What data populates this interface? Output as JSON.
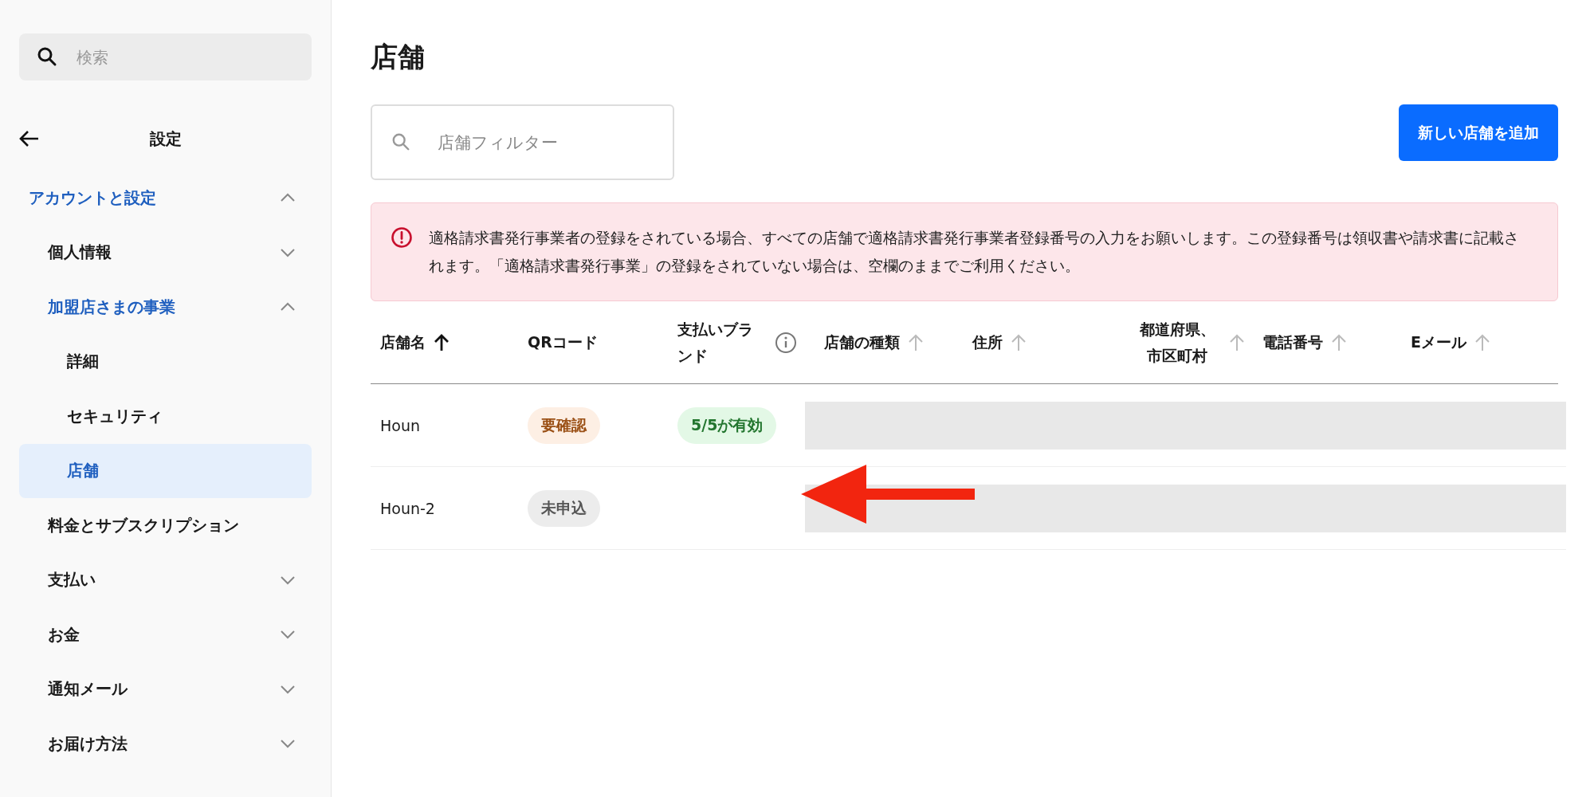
{
  "sidebar": {
    "search": {
      "placeholder": "検索"
    },
    "title": "設定",
    "items": [
      {
        "label": "アカウントと設定",
        "expanded": true,
        "selected": false,
        "children": [
          {
            "label": "個人情報",
            "expanded": false,
            "selected": false
          },
          {
            "label": "加盟店さまの事業",
            "expanded": true,
            "selected": false,
            "children": [
              {
                "label": "詳細",
                "selected": false
              },
              {
                "label": "セキュリティ",
                "selected": false
              },
              {
                "label": "店舗",
                "selected": true
              }
            ]
          },
          {
            "label": "料金とサブスクリプション",
            "selected": false
          },
          {
            "label": "支払い",
            "expanded": false,
            "selected": false
          },
          {
            "label": "お金",
            "expanded": false,
            "selected": false
          },
          {
            "label": "通知メール",
            "expanded": false,
            "selected": false
          },
          {
            "label": "お届け方法",
            "expanded": false,
            "selected": false
          }
        ]
      }
    ]
  },
  "page": {
    "title": "店舗",
    "filter": {
      "placeholder": "店舗フィルター"
    },
    "add_button": "新しい店舗を追加",
    "alert": "適格請求書発行事業者の登録をされている場合、すべての店舗で適格請求書発行事業者登録番号の入力をお願いします。この登録番号は領収書や請求書に記載されます。「適格請求書発行事業」の登録をされていない場合は、空欄のままでご利用ください。",
    "table": {
      "columns": [
        {
          "label": "店舗名",
          "sorted": true
        },
        {
          "label": "QRコード"
        },
        {
          "label": "支払いブランド",
          "info": true
        },
        {
          "label": "店舗の種類",
          "sorted": false
        },
        {
          "label": "住所",
          "sorted": false
        },
        {
          "label": "都道府県、市区町村",
          "sorted": false
        },
        {
          "label": "電話番号",
          "sorted": false
        },
        {
          "label": "Eメール",
          "sorted": false
        }
      ],
      "rows": [
        {
          "name": "Houn",
          "qr": {
            "label": "要確認",
            "kind": "warning"
          },
          "brands": {
            "label": "5/5が有効",
            "kind": "success"
          }
        },
        {
          "name": "Houn-2",
          "qr": {
            "label": "未申込",
            "kind": "neutral"
          }
        }
      ]
    }
  }
}
